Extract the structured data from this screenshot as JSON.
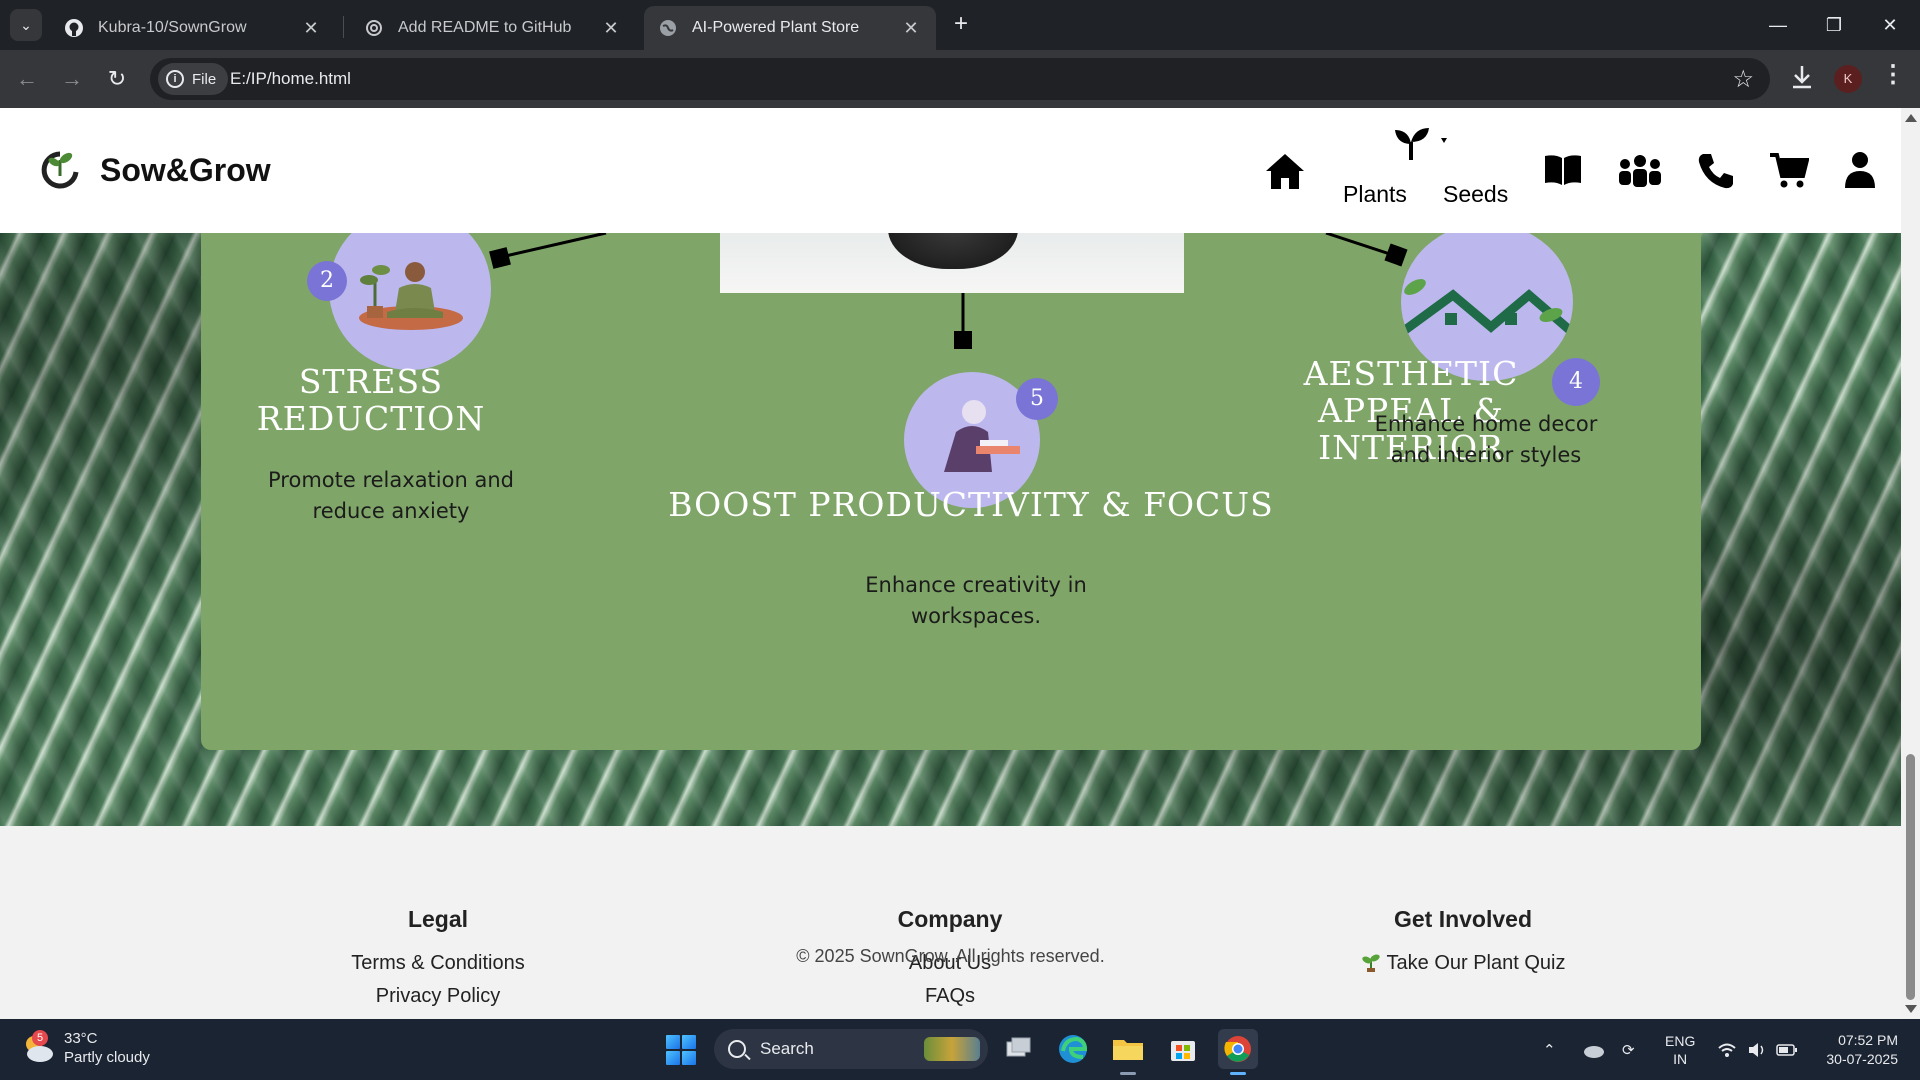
{
  "browser": {
    "tabs": [
      {
        "title": "Kubra-10/SownGrow",
        "icon": "github-icon",
        "active": false
      },
      {
        "title": "Add README to GitHub",
        "icon": "openai-icon",
        "active": false
      },
      {
        "title": "AI-Powered Plant Store",
        "icon": "globe-icon",
        "active": true
      }
    ],
    "new_tab": "+",
    "address": {
      "chip": "File",
      "url": "E:/IP/home.html"
    },
    "profile_initial": "K"
  },
  "site": {
    "brand": "Sow&Grow",
    "nav": {
      "plants": "Plants",
      "seeds": "Seeds",
      "icons": [
        "home-icon",
        "sprout-dropdown-icon",
        "book-icon",
        "community-icon",
        "phone-icon",
        "cart-icon",
        "user-icon"
      ]
    },
    "benefits": [
      {
        "number": "2",
        "title": "STRESS REDUCTION",
        "desc_line1": "Promote relaxation and",
        "desc_line2": "reduce anxiety"
      },
      {
        "number": "5",
        "title": "BOOST PRODUCTIVITY & FOCUS",
        "desc_line1": "Enhance creativity in",
        "desc_line2": "workspaces."
      },
      {
        "number": "4",
        "title_line1": "AESTHETIC APPEAL &",
        "title_line2": "INTERIOR",
        "desc_line1": "Enhance home decor",
        "desc_line2": "and interior styles"
      }
    ],
    "footer": {
      "legal": {
        "heading": "Legal",
        "links": [
          "Terms & Conditions",
          "Privacy Policy"
        ]
      },
      "company": {
        "heading": "Company",
        "links": [
          "About Us",
          "FAQs"
        ]
      },
      "involved": {
        "heading": "Get Involved",
        "links": [
          "Take Our Plant Quiz"
        ]
      },
      "copyright": "© 2025 SownGrow. All rights reserved."
    },
    "colors": {
      "panel": "#7fa668",
      "circle": "#bcb8ee",
      "badge": "#7a74d6"
    }
  },
  "taskbar": {
    "weather": {
      "temp": "33°C",
      "desc": "Partly cloudy",
      "badge": "5"
    },
    "search_placeholder": "Search",
    "lang": {
      "line1": "ENG",
      "line2": "IN"
    },
    "time": "07:52 PM",
    "date": "30-07-2025"
  }
}
